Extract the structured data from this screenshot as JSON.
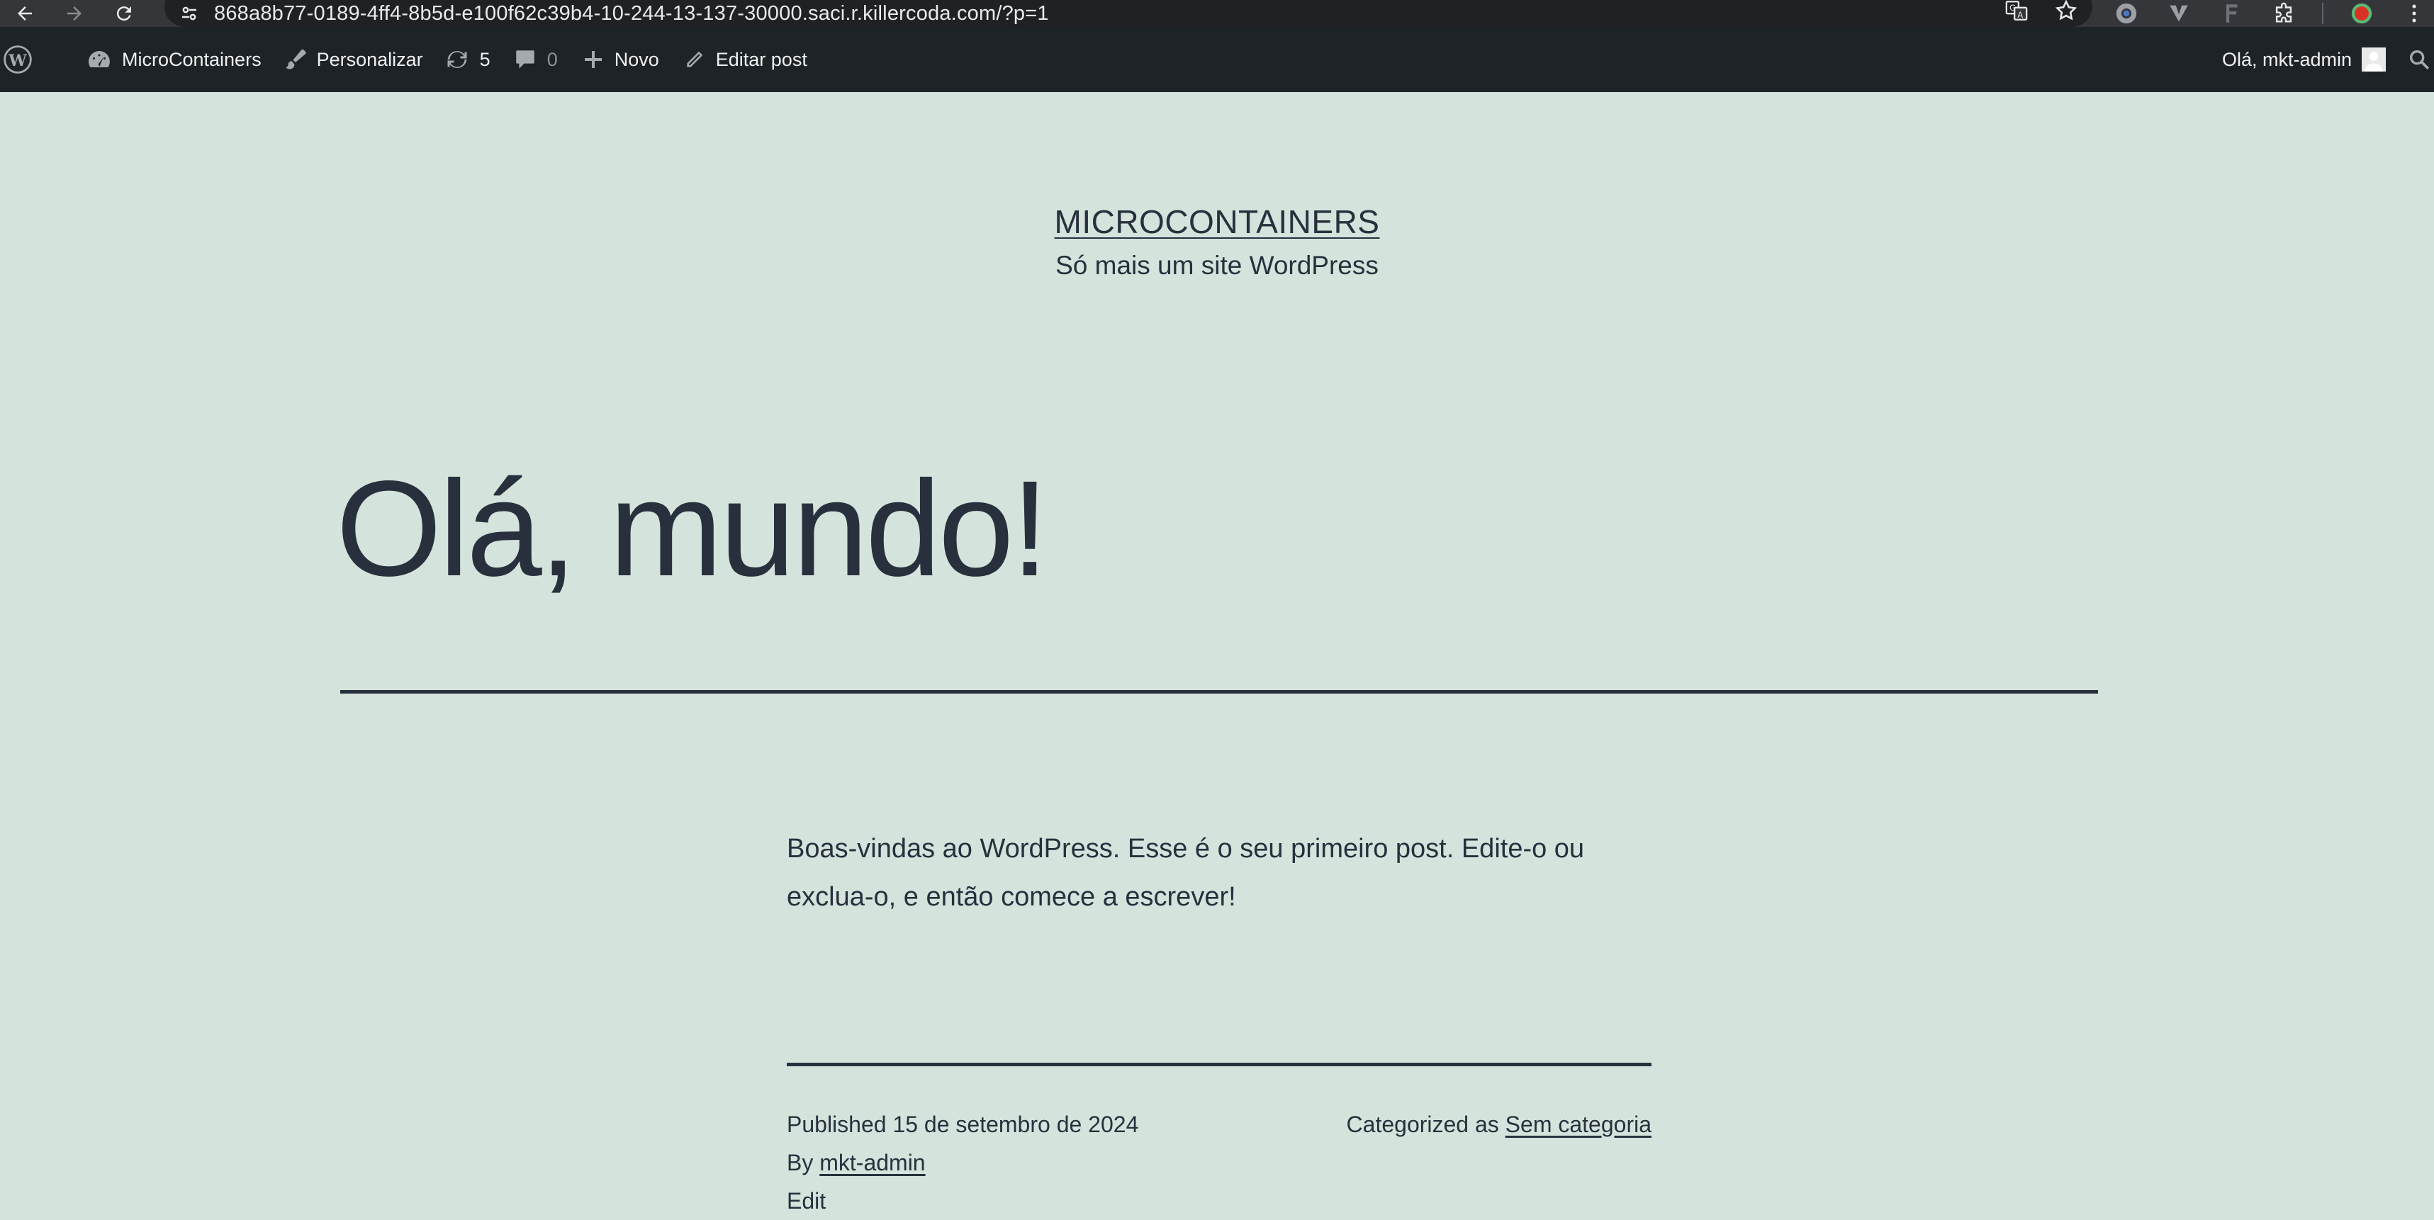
{
  "browser": {
    "url": "868a8b77-0189-4ff4-8b5d-e100f62c39b4-10-244-13-137-30000.saci.r.killercoda.com/?p=1"
  },
  "admin_bar": {
    "site_name": "MicroContainers",
    "customize_label": "Personalizar",
    "updates_count": "5",
    "comments_count": "0",
    "new_label": "Novo",
    "edit_post_label": "Editar post",
    "greeting": "Olá, mkt-admin"
  },
  "site": {
    "title": "MICROCONTAINERS",
    "description": "Só mais um site WordPress"
  },
  "post": {
    "title": "Olá, mundo!",
    "body": "Boas-vindas ao WordPress. Esse é o seu primeiro post. Edite-o ou exclua-o, e então comece a escrever!",
    "published_label": "Published",
    "published_date": "15 de setembro de 2024",
    "by_label": "By",
    "author": "mkt-admin",
    "categorized_label": "Categorized as",
    "category": "Sem categoria",
    "edit_label": "Edit"
  }
}
